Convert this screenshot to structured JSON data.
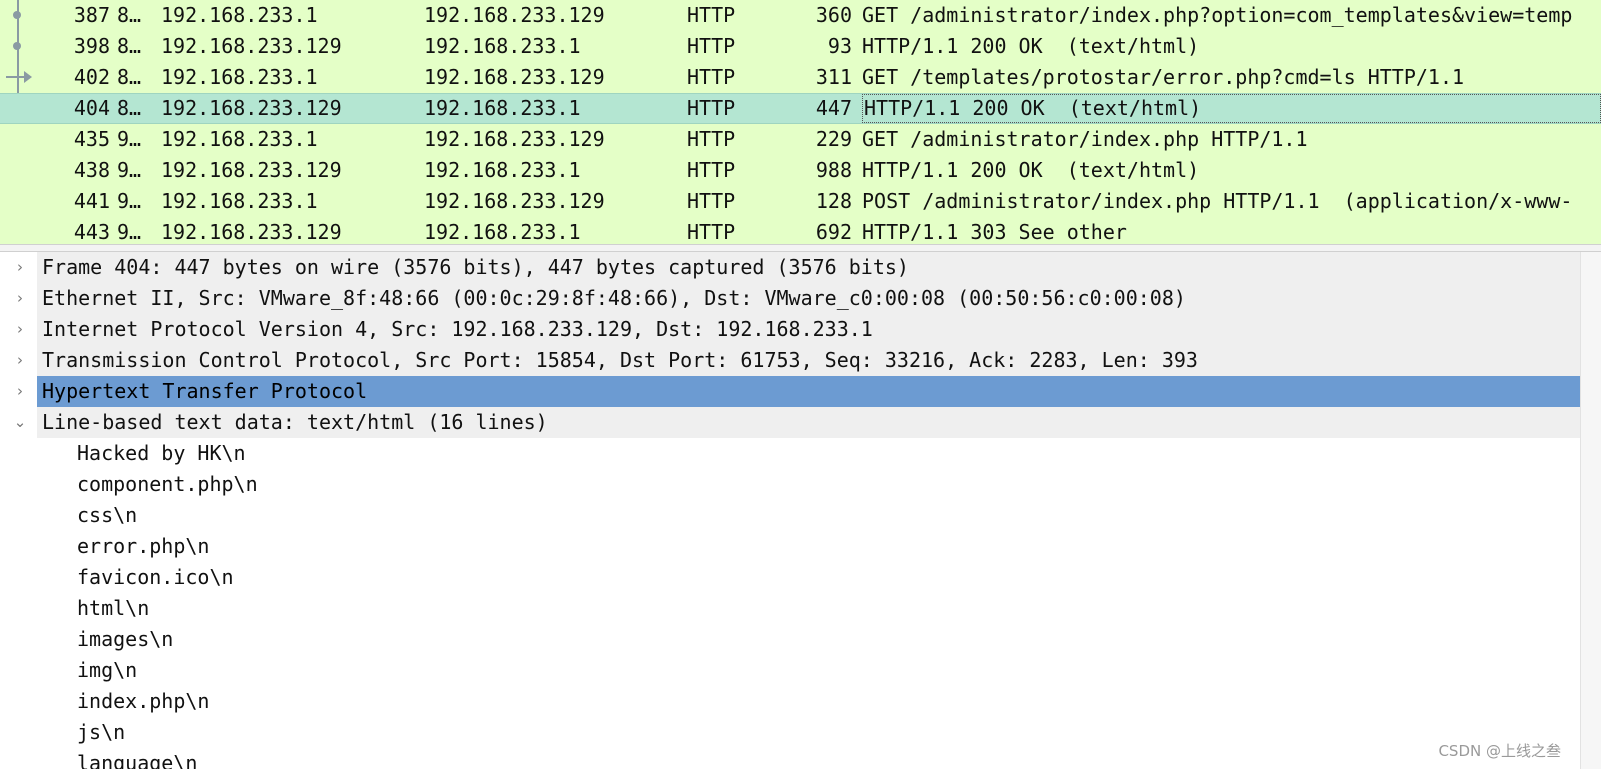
{
  "packets": [
    {
      "no": "387",
      "time": "8…",
      "src": "192.168.233.1",
      "dst": "192.168.233.129",
      "proto": "HTTP",
      "len": "360",
      "info": "GET /administrator/index.php?option=com_templates&view=temp"
    },
    {
      "no": "398",
      "time": "8…",
      "src": "192.168.233.129",
      "dst": "192.168.233.1",
      "proto": "HTTP",
      "len": "93",
      "info": "HTTP/1.1 200 OK  (text/html)"
    },
    {
      "no": "402",
      "time": "8…",
      "src": "192.168.233.1",
      "dst": "192.168.233.129",
      "proto": "HTTP",
      "len": "311",
      "info": "GET /templates/protostar/error.php?cmd=ls HTTP/1.1"
    },
    {
      "no": "404",
      "time": "8…",
      "src": "192.168.233.129",
      "dst": "192.168.233.1",
      "proto": "HTTP",
      "len": "447",
      "info": "HTTP/1.1 200 OK  (text/html)"
    },
    {
      "no": "435",
      "time": "9…",
      "src": "192.168.233.1",
      "dst": "192.168.233.129",
      "proto": "HTTP",
      "len": "229",
      "info": "GET /administrator/index.php HTTP/1.1"
    },
    {
      "no": "438",
      "time": "9…",
      "src": "192.168.233.129",
      "dst": "192.168.233.1",
      "proto": "HTTP",
      "len": "988",
      "info": "HTTP/1.1 200 OK  (text/html)"
    },
    {
      "no": "441",
      "time": "9…",
      "src": "192.168.233.1",
      "dst": "192.168.233.129",
      "proto": "HTTP",
      "len": "128",
      "info": "POST /administrator/index.php HTTP/1.1  (application/x-www-"
    },
    {
      "no": "443",
      "time": "9…",
      "src": "192.168.233.129",
      "dst": "192.168.233.1",
      "proto": "HTTP",
      "len": "692",
      "info": "HTTP/1.1 303 See other"
    }
  ],
  "selected_packet": "404",
  "details": [
    {
      "label": "Frame 404: 447 bytes on wire (3576 bits), 447 bytes captured (3576 bits)",
      "expanded": false
    },
    {
      "label": "Ethernet II, Src: VMware_8f:48:66 (00:0c:29:8f:48:66), Dst: VMware_c0:00:08 (00:50:56:c0:00:08)",
      "expanded": false
    },
    {
      "label": "Internet Protocol Version 4, Src: 192.168.233.129, Dst: 192.168.233.1",
      "expanded": false
    },
    {
      "label": "Transmission Control Protocol, Src Port: 15854, Dst Port: 61753, Seq: 33216, Ack: 2283, Len: 393",
      "expanded": false
    },
    {
      "label": "Hypertext Transfer Protocol",
      "expanded": false,
      "highlighted": true
    },
    {
      "label": "Line-based text data: text/html (16 lines)",
      "expanded": true
    }
  ],
  "text_lines": [
    "Hacked by HK\\n",
    "component.php\\n",
    "css\\n",
    "error.php\\n",
    "favicon.ico\\n",
    "html\\n",
    "images\\n",
    "img\\n",
    "index.php\\n",
    "js\\n",
    "language\\n"
  ],
  "icons": {
    "collapsed": "chevron-right-icon",
    "expanded": "chevron-down-icon"
  },
  "colors": {
    "http_row_bg": "#e4ffc7",
    "selected_row_bg": "#b4e6d2",
    "highlight_bg": "#6c9bd2"
  },
  "watermark": "CSDN @上线之叁"
}
